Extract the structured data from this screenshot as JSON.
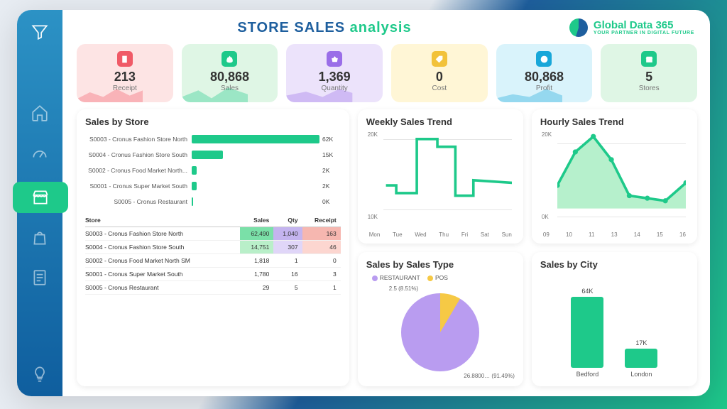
{
  "title": {
    "a": "STORE SALES",
    "b": "analysis"
  },
  "brand": {
    "name_a": "Global Data",
    "name_b": " 365",
    "tag": "YOUR PARTNER IN DIGITAL FUTURE"
  },
  "kpis": [
    {
      "value": "213",
      "label": "Receipt",
      "bg": "#fde4e4",
      "icon_bg": "#f05a67"
    },
    {
      "value": "80,868",
      "label": "Sales",
      "bg": "#dff6e5",
      "icon_bg": "#1ec98a"
    },
    {
      "value": "1,369",
      "label": "Quantity",
      "bg": "#ece3fb",
      "icon_bg": "#9a6ee8"
    },
    {
      "value": "0",
      "label": "Cost",
      "bg": "#fff6d6",
      "icon_bg": "#f2c23a"
    },
    {
      "value": "80,868",
      "label": "Profit",
      "bg": "#d9f3fb",
      "icon_bg": "#18a7d9"
    },
    {
      "value": "5",
      "label": "Stores",
      "bg": "#dff6e5",
      "icon_bg": "#1ec98a"
    }
  ],
  "panels": {
    "salesByStore": {
      "title": "Sales by Store",
      "rows": [
        {
          "label": "S0003 - Cronus Fashion Store North",
          "value": "62K"
        },
        {
          "label": "S0004 - Cronus Fashion Store South",
          "value": "15K"
        },
        {
          "label": "S0002 - Cronus Food Market North...",
          "value": "2K"
        },
        {
          "label": "S0001 - Cronus Super Market South",
          "value": "2K"
        },
        {
          "label": "S0005 - Cronus Restaurant",
          "value": "0K"
        }
      ]
    },
    "table": {
      "headers": [
        "Store",
        "Sales",
        "Qty",
        "Receipt"
      ],
      "rows": [
        {
          "c0": "S0003 - Cronus Fashion Store North",
          "c1": "62,490",
          "c2": "1,040",
          "c3": "163"
        },
        {
          "c0": "S0004 - Cronus Fashion Store South",
          "c1": "14,751",
          "c2": "307",
          "c3": "46"
        },
        {
          "c0": "S0002 - Cronus Food Market North SM",
          "c1": "1,818",
          "c2": "1",
          "c3": "0"
        },
        {
          "c0": "S0001 - Cronus Super Market South",
          "c1": "1,780",
          "c2": "16",
          "c3": "3"
        },
        {
          "c0": "S0005 - Cronus Restaurant",
          "c1": "29",
          "c2": "5",
          "c3": "1"
        }
      ]
    },
    "weekly": {
      "title": "Weekly Sales Trend",
      "yticks": [
        "20K",
        "10K"
      ],
      "xticks": [
        "Mon",
        "Tue",
        "Wed",
        "Thu",
        "Fri",
        "Sat",
        "Sun"
      ]
    },
    "hourly": {
      "title": "Hourly Sales Trend",
      "yticks": [
        "20K",
        "0K"
      ],
      "xticks": [
        "09",
        "10",
        "11",
        "13",
        "14",
        "15",
        "16"
      ]
    },
    "salesType": {
      "title": "Sales by Sales Type",
      "legend": {
        "restaurant": "RESTAURANT",
        "pos": "POS"
      },
      "labels": {
        "small": "2.5 (8.51%)",
        "big": "26.8800… (91.49%)"
      }
    },
    "city": {
      "title": "Sales by City",
      "cols": [
        {
          "label": "Bedford",
          "value": "64K"
        },
        {
          "label": "London",
          "value": "17K"
        }
      ]
    }
  },
  "chart_data": [
    {
      "type": "bar",
      "title": "Sales by Store",
      "orientation": "horizontal",
      "categories": [
        "S0003 - Cronus Fashion Store North",
        "S0004 - Cronus Fashion Store South",
        "S0002 - Cronus Food Market North",
        "S0001 - Cronus Super Market South",
        "S0005 - Cronus Restaurant"
      ],
      "values": [
        62000,
        15000,
        2000,
        2000,
        0
      ],
      "xlim": [
        0,
        65000
      ]
    },
    {
      "type": "table",
      "title": "Store metrics",
      "columns": [
        "Store",
        "Sales",
        "Qty",
        "Receipt"
      ],
      "rows": [
        [
          "S0003 - Cronus Fashion Store North",
          62490,
          1040,
          163
        ],
        [
          "S0004 - Cronus Fashion Store South",
          14751,
          307,
          46
        ],
        [
          "S0002 - Cronus Food Market North SM",
          1818,
          1,
          0
        ],
        [
          "S0001 - Cronus Super Market South",
          1780,
          16,
          3
        ],
        [
          "S0005 - Cronus Restaurant",
          29,
          5,
          1
        ]
      ]
    },
    {
      "type": "line",
      "title": "Weekly Sales Trend",
      "x": [
        "Mon",
        "Tue",
        "Wed",
        "Thu",
        "Fri",
        "Sat",
        "Sun"
      ],
      "values": [
        10000,
        8000,
        21000,
        21000,
        8500,
        11000,
        11000
      ],
      "ylim": [
        5000,
        22000
      ]
    },
    {
      "type": "area",
      "title": "Hourly Sales Trend",
      "x": [
        9,
        10,
        11,
        12,
        13,
        14,
        15,
        16
      ],
      "values": [
        6000,
        18000,
        24000,
        15000,
        4000,
        3000,
        2000,
        8000
      ],
      "ylim": [
        0,
        25000
      ]
    },
    {
      "type": "pie",
      "title": "Sales by Sales Type",
      "categories": [
        "RESTAURANT",
        "POS"
      ],
      "values": [
        26.88,
        2.5
      ],
      "percent": [
        91.49,
        8.51
      ]
    },
    {
      "type": "bar",
      "title": "Sales by City",
      "categories": [
        "Bedford",
        "London"
      ],
      "values": [
        64000,
        17000
      ],
      "ylim": [
        0,
        70000
      ]
    }
  ]
}
